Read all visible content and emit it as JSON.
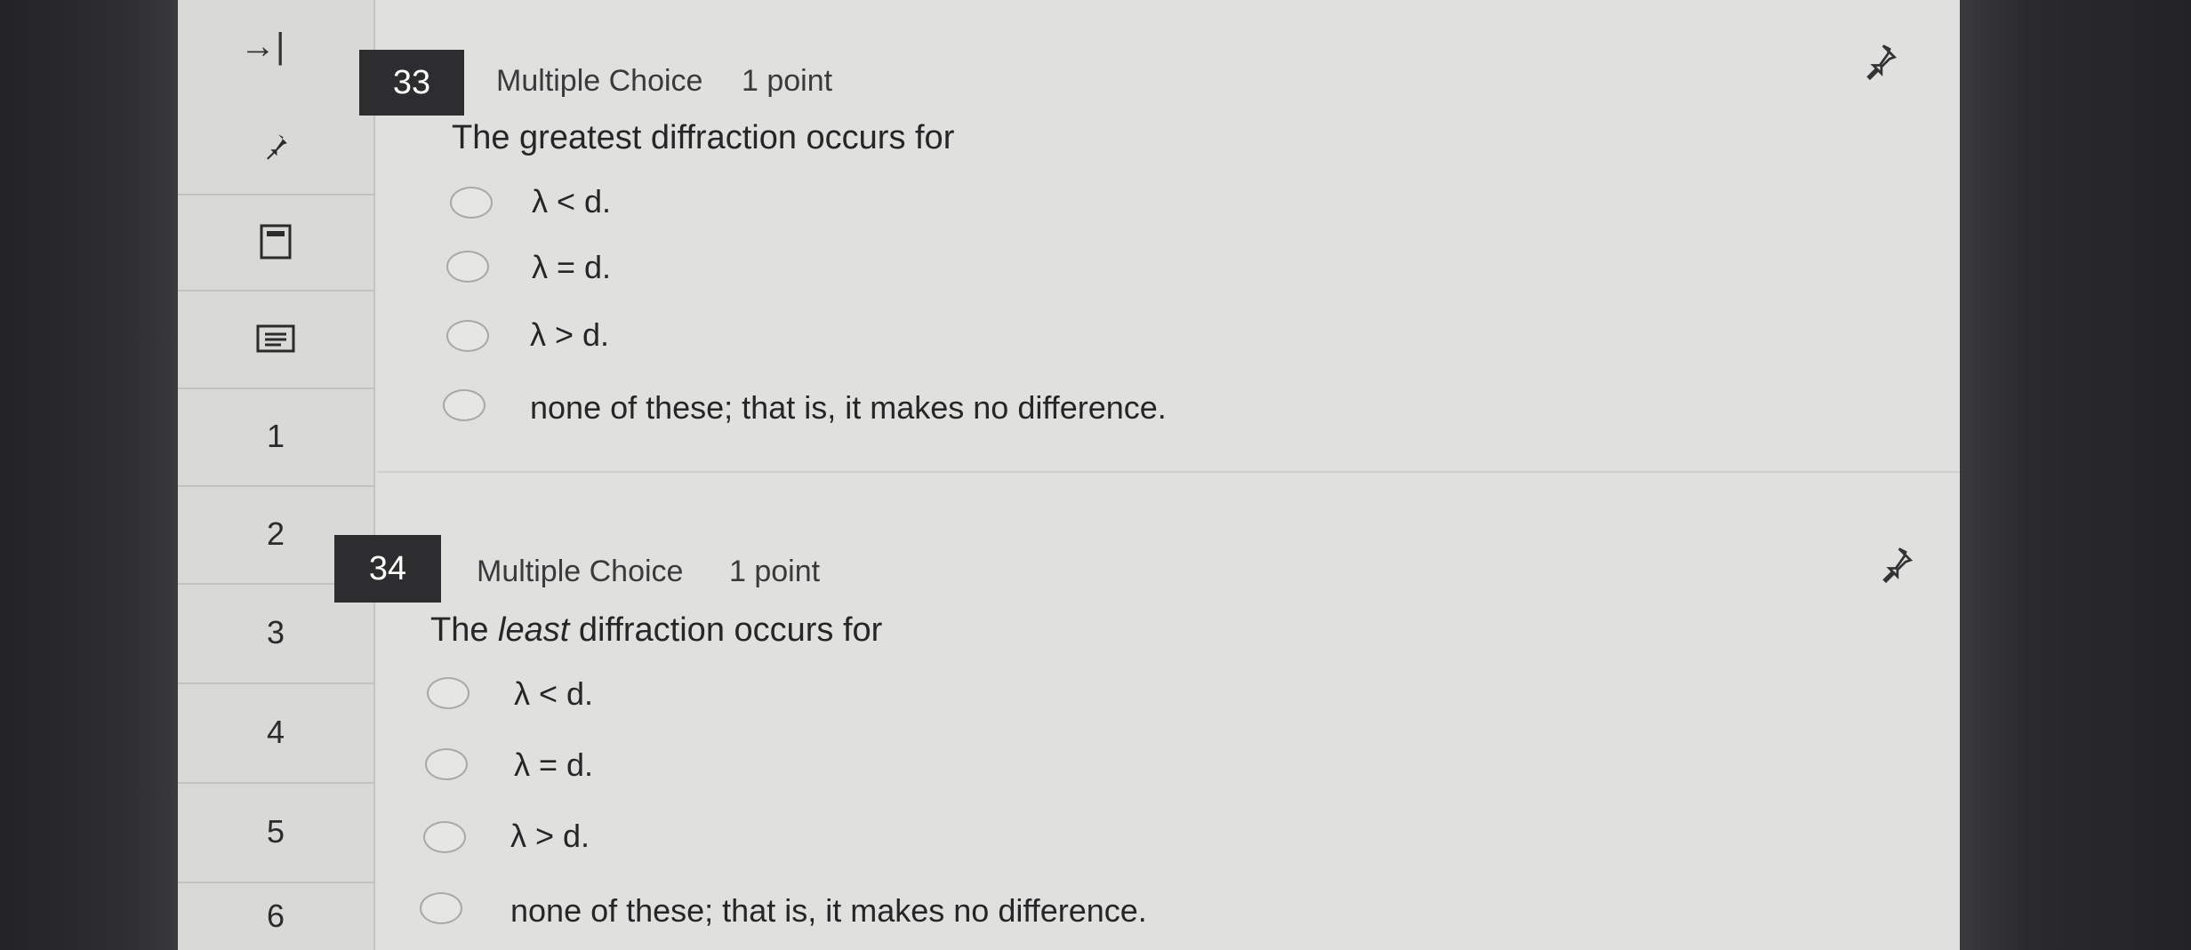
{
  "sidebar": {
    "collapse_icon": "→|",
    "items": [
      {
        "label": "1"
      },
      {
        "label": "2"
      },
      {
        "label": "3"
      },
      {
        "label": "4"
      },
      {
        "label": "5"
      },
      {
        "label": "6"
      }
    ]
  },
  "questions": [
    {
      "number": "33",
      "type": "Multiple Choice",
      "points": "1 point",
      "text_before": "The greatest diffraction occurs for",
      "options": [
        "λ < d.",
        "λ = d.",
        "λ > d.",
        "none of these; that is, it makes no difference."
      ]
    },
    {
      "number": "34",
      "type": "Multiple Choice",
      "points": "1 point",
      "text_before": "The ",
      "text_emphasis": "least",
      "text_after": " diffraction occurs for",
      "options": [
        "λ < d.",
        "λ = d.",
        "λ > d.",
        "none of these; that is, it makes no difference."
      ]
    }
  ]
}
